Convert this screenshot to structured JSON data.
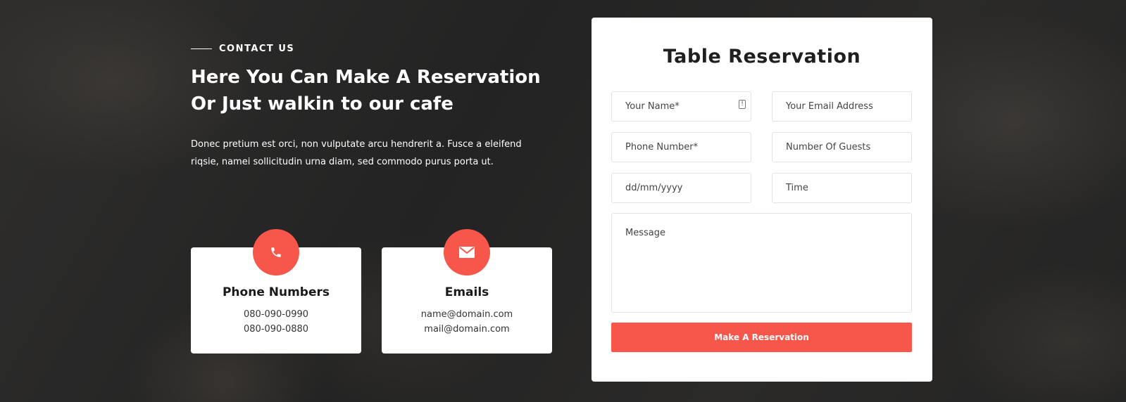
{
  "contact": {
    "eyebrow": "CONTACT US",
    "heading": "Here You Can Make A Reservation Or Just walkin to our cafe",
    "description": "Donec pretium est orci, non vulputate arcu hendrerit a. Fusce a eleifend riqsie, namei sollicitudin urna diam, sed commodo purus porta ut."
  },
  "cards": {
    "phone": {
      "icon": "phone-icon",
      "title": "Phone Numbers",
      "line1": "080-090-0990",
      "line2": "080-090-0880"
    },
    "email": {
      "icon": "envelope-icon",
      "title": "Emails",
      "line1": "name@domain.com",
      "line2": "mail@domain.com"
    }
  },
  "form": {
    "title": "Table Reservation",
    "name_placeholder": "Your Name*",
    "email_placeholder": "Your Email Address",
    "phone_placeholder": "Phone Number*",
    "guests_placeholder": "Number Of Guests",
    "date_placeholder": "dd/mm/yyyy",
    "time_placeholder": "Time",
    "message_placeholder": "Message",
    "submit_label": "Make A Reservation"
  },
  "colors": {
    "accent": "#f7574a",
    "background": "#2a2a2a",
    "card": "#ffffff"
  }
}
